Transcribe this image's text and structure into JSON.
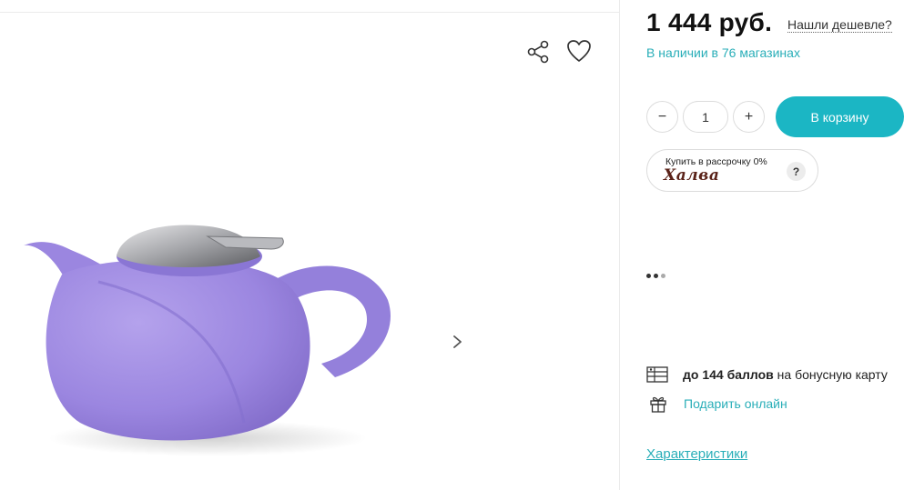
{
  "gallery": {
    "image_alt": "Заварочный чайник фиолетовый",
    "icons": {
      "share": "share-icon",
      "favorite": "heart-icon",
      "next": "chevron-right-icon"
    }
  },
  "product": {
    "price": "1 444 руб.",
    "cheaper_link": "Нашли дешевле?",
    "availability": "В наличии в 76 магазинах",
    "quantity": "1",
    "minus_label": "−",
    "plus_label": "+",
    "cart_label": "В корзину",
    "installment": {
      "caption": "Купить в рассрочку 0%",
      "brand": "Халва",
      "help": "?"
    },
    "bonus": {
      "bold": "до 144 баллов",
      "rest": " на бонусную карту"
    },
    "gift_link": "Подарить онлайн",
    "specs_link": "Характеристики"
  },
  "colors": {
    "accent": "#1bb6c4",
    "link": "#29aeb8",
    "teapot": "#9b86e0",
    "halva_brand": "#5a2218"
  }
}
